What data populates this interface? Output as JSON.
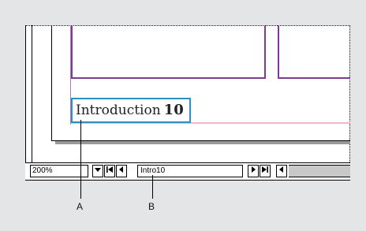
{
  "document": {
    "folio_text": "Introduction",
    "folio_number": "10"
  },
  "statusbar": {
    "zoom_value": "200%",
    "zoom_menu_icon": "triangle-down",
    "first_page_icon": "first-page-arrow",
    "prev_page_icon": "triangle-left",
    "page_value": "Intro10",
    "next_page_icon": "triangle-right",
    "last_page_icon": "last-page-arrow",
    "scroll_left_icon": "triangle-left"
  },
  "callouts": {
    "a_label": "A",
    "b_label": "B"
  },
  "colors": {
    "frame_purple": "#7b3d92",
    "folio_frame_blue": "#2d8fc4",
    "margin_pink": "#f2b6cc",
    "background_gray": "#e4e5e6"
  }
}
